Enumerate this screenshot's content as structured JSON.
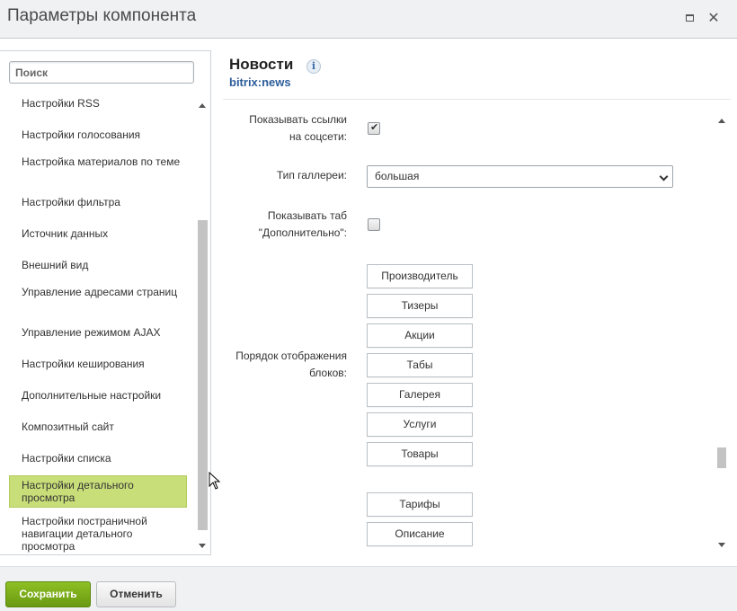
{
  "window": {
    "title": "Параметры компонента"
  },
  "sidebar": {
    "search_placeholder": "Поиск",
    "items": [
      {
        "label": "Настройки RSS"
      },
      {
        "label": "Настройки голосования"
      },
      {
        "label": "Настройка материалов по теме"
      },
      {
        "label": "Настройки фильтра"
      },
      {
        "label": "Источник данных"
      },
      {
        "label": "Внешний вид"
      },
      {
        "label": "Управление адресами страниц"
      },
      {
        "label": "Управление режимом AJAX"
      },
      {
        "label": "Настройки кеширования"
      },
      {
        "label": "Дополнительные настройки"
      },
      {
        "label": "Композитный сайт"
      },
      {
        "label": "Настройки списка"
      },
      {
        "label": "Настройки детального просмотра"
      },
      {
        "label": "Настройки постраничной навигации детального просмотра"
      }
    ],
    "active_item": "Настройки детального просмотра"
  },
  "component": {
    "title": "Новости",
    "code": "bitrix:news",
    "info_icon": "info-icon"
  },
  "form": {
    "social_links": {
      "label": "Показывать ссылки на соцсети:",
      "checked": true
    },
    "gallery_type": {
      "label": "Тип галлереи:",
      "value": "большая"
    },
    "extra_tab": {
      "label": "Показывать таб \"Дополнительно\":",
      "checked": false
    },
    "blocks_order": {
      "label": "Порядок отображения блоков:",
      "items": [
        "Производитель",
        "Тизеры",
        "Акции",
        "Табы",
        "Галерея",
        "Услуги",
        "Товары"
      ],
      "items_after_gap": [
        "Тарифы",
        "Описание"
      ]
    }
  },
  "footer": {
    "save_label": "Сохранить",
    "cancel_label": "Отменить"
  },
  "colors": {
    "active_item_bg": "#c8de79",
    "save_button": "#7aad19",
    "link_blue": "#2c5d9a"
  }
}
